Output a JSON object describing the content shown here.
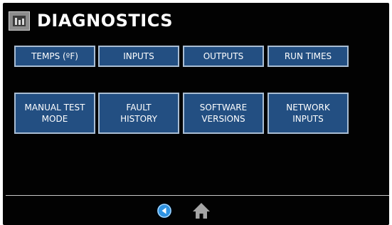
{
  "header": {
    "title": "DIAGNOSTICS",
    "icon": "diagnostics-chart-icon"
  },
  "buttons": {
    "row1": [
      {
        "label": "TEMPS (ºF)"
      },
      {
        "label": "INPUTS"
      },
      {
        "label": "OUTPUTS"
      },
      {
        "label": "RUN TIMES"
      }
    ],
    "row2": [
      {
        "label": "MANUAL TEST\nMODE"
      },
      {
        "label": "FAULT\nHISTORY"
      },
      {
        "label": "SOFTWARE\nVERSIONS"
      },
      {
        "label": "NETWORK\nINPUTS"
      }
    ]
  },
  "footer": {
    "back_icon": "back-arrow-icon",
    "home_icon": "home-icon"
  },
  "colors": {
    "background": "#020202",
    "button_fill": "#234f82",
    "button_border": "#a9bdd3",
    "back_icon": "#2f93e2",
    "home_icon": "#a5a5a5"
  }
}
